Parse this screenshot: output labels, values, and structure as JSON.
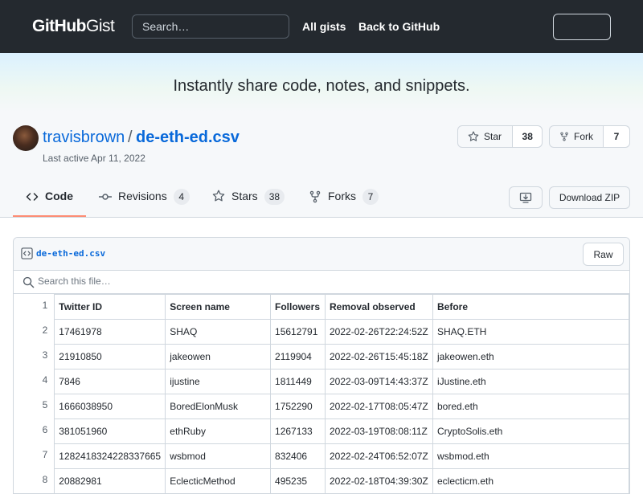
{
  "header": {
    "logo_bold": "GitHub",
    "logo_light": "Gist",
    "search_placeholder": "Search…",
    "nav": [
      "All gists",
      "Back to GitHub"
    ]
  },
  "banner": {
    "text": "Instantly share code, notes, and snippets."
  },
  "gist": {
    "owner": "travisbrown",
    "separator": "/",
    "name": "de-eth-ed.csv",
    "last_active": "Last active Apr 11, 2022",
    "star_label": "Star",
    "star_count": "38",
    "fork_label": "Fork",
    "fork_count": "7"
  },
  "tabs": [
    {
      "label": "Code",
      "count": ""
    },
    {
      "label": "Revisions",
      "count": "4"
    },
    {
      "label": "Stars",
      "count": "38"
    },
    {
      "label": "Forks",
      "count": "7"
    }
  ],
  "actions": {
    "download_zip": "Download ZIP",
    "raw": "Raw"
  },
  "file": {
    "name": "de-eth-ed.csv",
    "search_placeholder": "Search this file…",
    "columns": [
      "Twitter ID",
      "Screen name",
      "Followers",
      "Removal observed",
      "Before"
    ],
    "rows": [
      [
        "17461978",
        "SHAQ",
        "15612791",
        "2022-02-26T22:24:52Z",
        "SHAQ.ETH"
      ],
      [
        "21910850",
        "jakeowen",
        "2119904",
        "2022-02-26T15:45:18Z",
        "jakeowen.eth"
      ],
      [
        "7846",
        "ijustine",
        "1811449",
        "2022-03-09T14:43:37Z",
        "iJustine.eth"
      ],
      [
        "1666038950",
        "BoredElonMusk",
        "1752290",
        "2022-02-17T08:05:47Z",
        "bored.eth"
      ],
      [
        "381051960",
        "ethRuby",
        "1267133",
        "2022-03-19T08:08:11Z",
        "CryptoSolis.eth"
      ],
      [
        "1282418324228337665",
        "wsbmod",
        "832406",
        "2022-02-24T06:52:07Z",
        "wsbmod.eth"
      ],
      [
        "20882981",
        "EclecticMethod",
        "495235",
        "2022-02-18T04:39:30Z",
        "eclecticm.eth"
      ]
    ],
    "line_numbers": [
      "1",
      "2",
      "3",
      "4",
      "5",
      "6",
      "7",
      "8"
    ]
  }
}
